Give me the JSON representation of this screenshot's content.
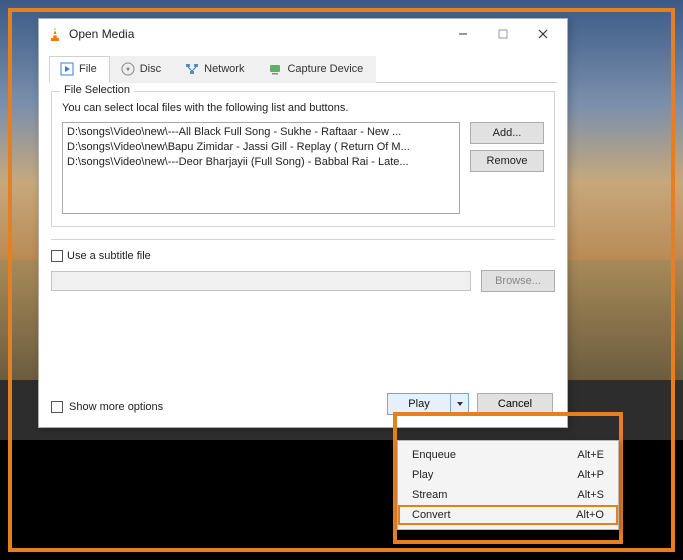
{
  "window": {
    "title": "Open Media"
  },
  "tabs": {
    "file": "File",
    "disc": "Disc",
    "network": "Network",
    "capture": "Capture Device"
  },
  "fileSelection": {
    "legend": "File Selection",
    "hint": "You can select local files with the following list and buttons.",
    "files": [
      "D:\\songs\\Video\\new\\---All Black Full Song - Sukhe - Raftaar -  New ...",
      "D:\\songs\\Video\\new\\Bapu Zimidar - Jassi Gill - Replay ( Return Of M...",
      "D:\\songs\\Video\\new\\---Deor Bharjayii (Full Song) - Babbal Rai - Late..."
    ],
    "addBtn": "Add...",
    "removeBtn": "Remove"
  },
  "subtitle": {
    "checkbox": "Use a subtitle file",
    "browseBtn": "Browse..."
  },
  "showMore": "Show more options",
  "actions": {
    "play": "Play",
    "cancel": "Cancel"
  },
  "dropdown": [
    {
      "label": "Enqueue",
      "shortcut": "Alt+E"
    },
    {
      "label": "Play",
      "shortcut": "Alt+P"
    },
    {
      "label": "Stream",
      "shortcut": "Alt+S"
    },
    {
      "label": "Convert",
      "shortcut": "Alt+O"
    }
  ]
}
